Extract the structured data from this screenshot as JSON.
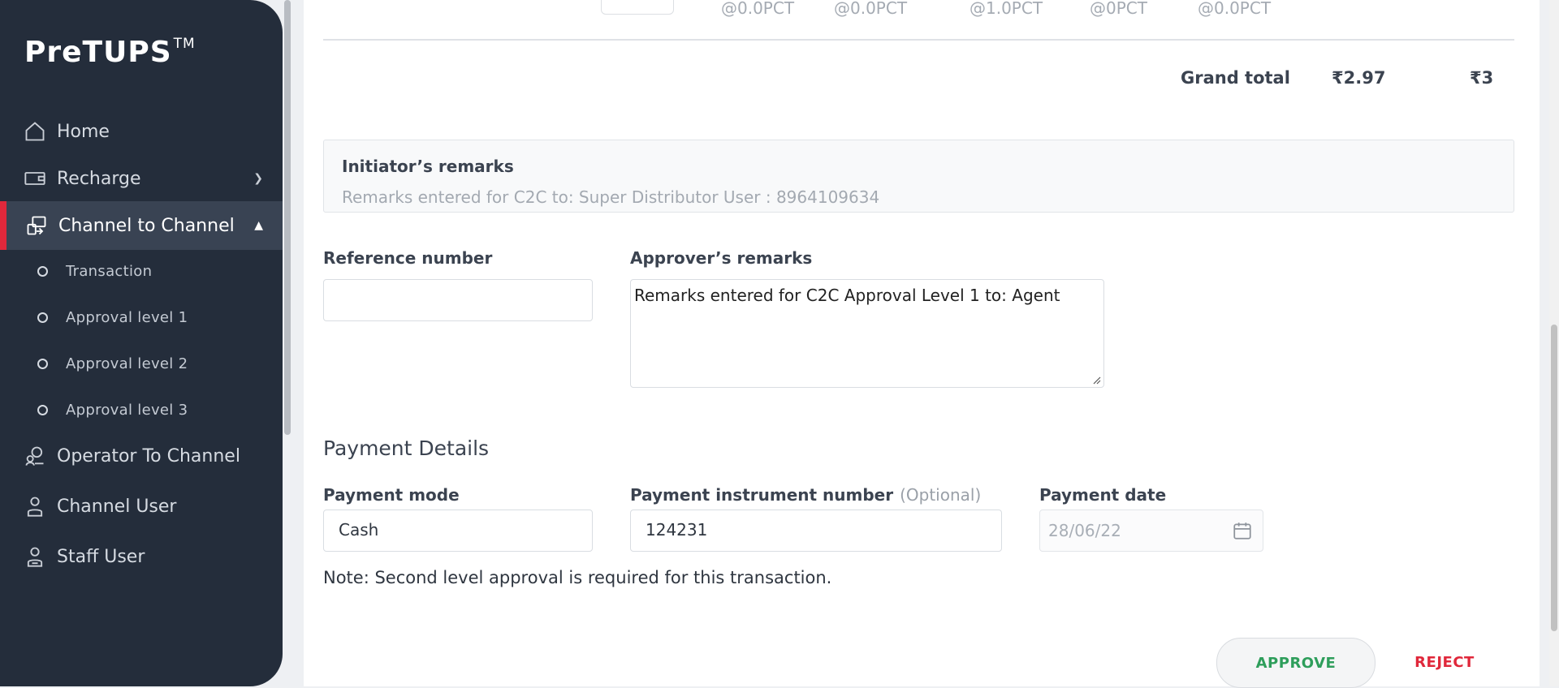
{
  "sidebar": {
    "brand": "PreTUPS",
    "brand_tm": "TM",
    "items": [
      {
        "label": "Home",
        "icon": "home-icon"
      },
      {
        "label": "Recharge",
        "icon": "recharge-icon"
      },
      {
        "label": "Channel to Channel",
        "icon": "channel-transfer-icon",
        "active": true
      },
      {
        "label": "Operator To Channel",
        "icon": "operator-icon"
      },
      {
        "label": "Channel User",
        "icon": "user-icon"
      },
      {
        "label": "Staff User",
        "icon": "staff-icon"
      }
    ],
    "sub_items": [
      {
        "label": "Transaction"
      },
      {
        "label": "Approval level 1"
      },
      {
        "label": "Approval level 2"
      },
      {
        "label": "Approval level 3"
      }
    ]
  },
  "table_tail": {
    "cells": [
      "@0.0PCT",
      "@0.0PCT",
      "@1.0PCT",
      "@0PCT",
      "@0.0PCT"
    ]
  },
  "totals": {
    "label": "Grand total",
    "value_1": "₹2.97",
    "value_2": "₹3"
  },
  "initiator": {
    "title": "Initiator’s remarks",
    "text": "Remarks entered for C2C to: Super Distributor User : 8964109634"
  },
  "form": {
    "reference_label": "Reference number",
    "reference_value": "",
    "approver_label": "Approver’s remarks",
    "approver_value": "Remarks entered for C2C Approval Level 1 to: Agent"
  },
  "payment": {
    "title": "Payment Details",
    "mode_label": "Payment mode",
    "mode_value": "Cash",
    "instrument_label": "Payment instrument number",
    "instrument_optional": "(Optional)",
    "instrument_value": "124231",
    "date_label": "Payment date",
    "date_value": "28/06/22"
  },
  "note": "Note: Second level approval is required for this transaction.",
  "actions": {
    "approve": "APPROVE",
    "reject": "REJECT"
  },
  "colors": {
    "sidebar_bg": "#242d3b",
    "active_accent": "#e0283b",
    "approve_text": "#2e9e5b",
    "reject_text": "#e0283b"
  }
}
